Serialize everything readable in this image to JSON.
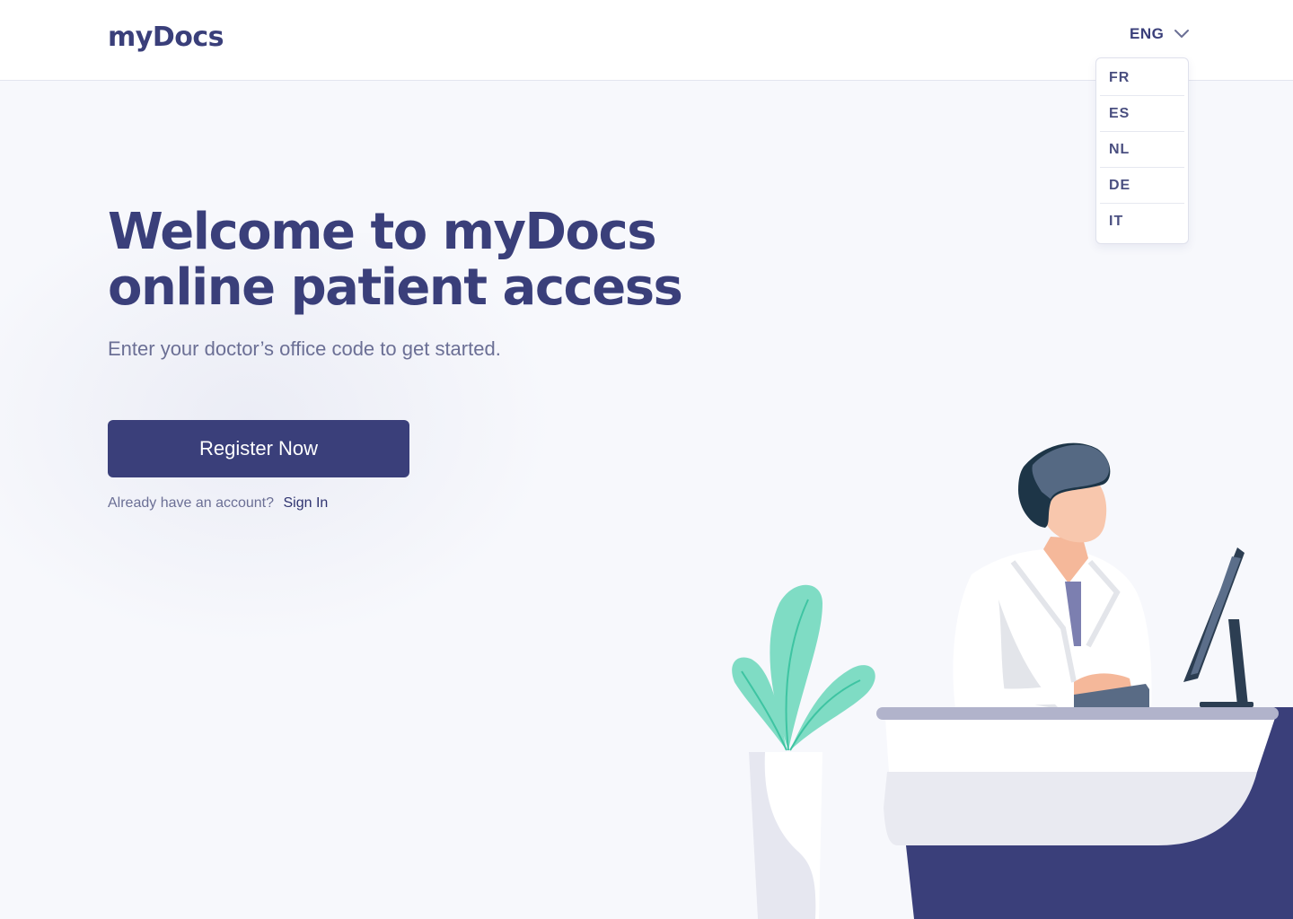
{
  "header": {
    "logo": "myDocs",
    "language": {
      "current": "ENG",
      "options": [
        "FR",
        "ES",
        "NL",
        "DE",
        "IT"
      ]
    }
  },
  "hero": {
    "title_line1": "Welcome to myDocs",
    "title_line2": "online patient access",
    "subtitle": "Enter your doctor’s office code to get started.",
    "register_label": "Register Now",
    "account_prompt": "Already have an account?",
    "signin_label": "Sign In"
  },
  "icons": {
    "language_toggle": "chevron-down-icon",
    "illustration": "doctor-at-desk-illustration"
  },
  "colors": {
    "brand": "#3a3f7a",
    "background": "#f7f8fc",
    "plant": "#7fdcc4"
  }
}
